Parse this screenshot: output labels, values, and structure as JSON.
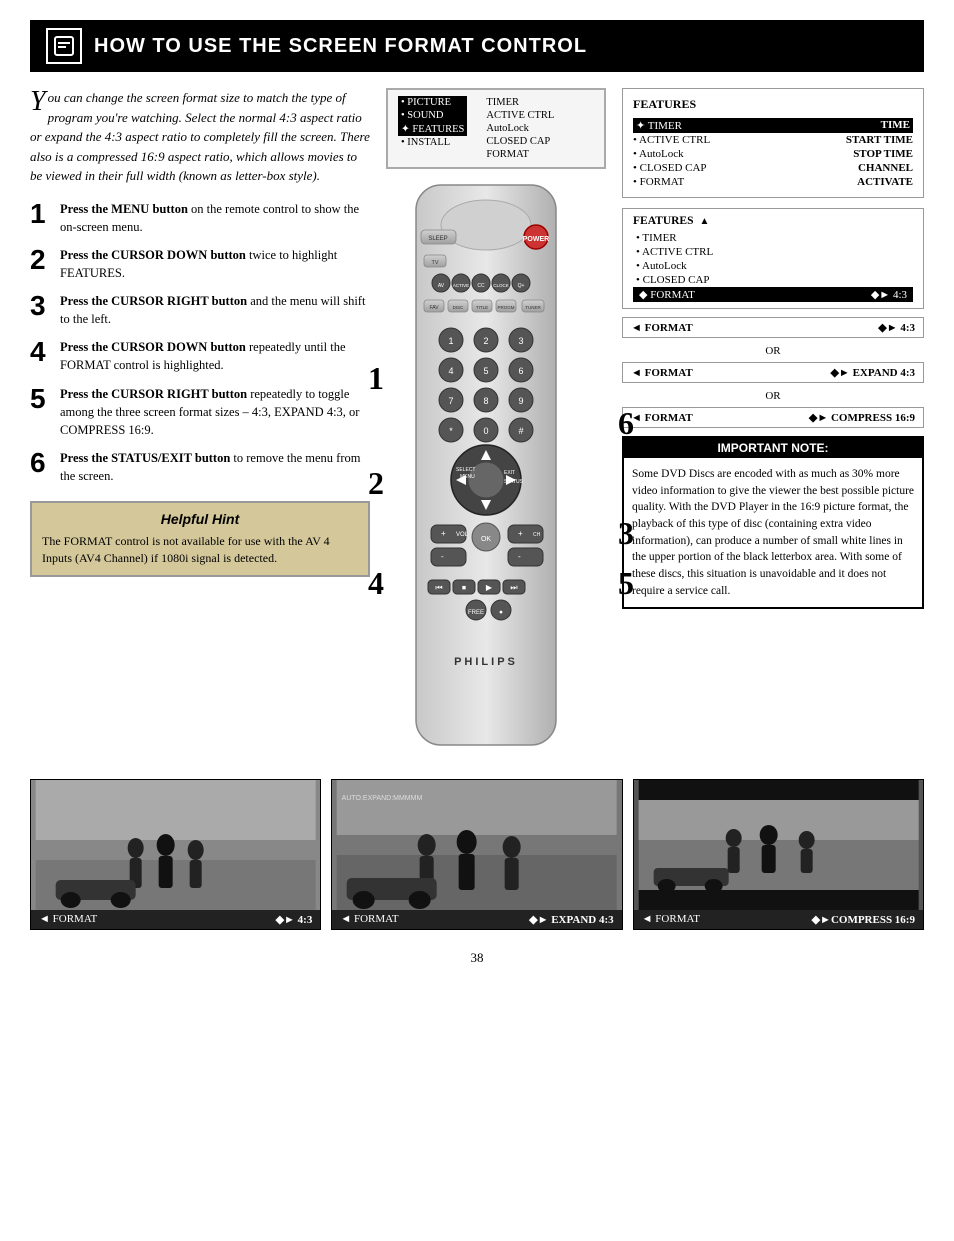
{
  "header": {
    "icon": "📋",
    "title": "How to Use the Screen Format Control"
  },
  "intro": {
    "text": "ou can change the screen format size to match the type of program you're watching. Select the normal 4:3 aspect ratio or expand the 4:3 aspect ratio to completely fill the screen. There also is a compressed 16:9 aspect ratio, which allows movies to be viewed in their full width (known as letter-box style)."
  },
  "steps": [
    {
      "number": "1",
      "bold_part": "Press the MENU button",
      "rest_part": " on the remote control to show the on-screen menu."
    },
    {
      "number": "2",
      "bold_part": "Press the CURSOR DOWN button",
      "rest_part": " twice to highlight FEATURES."
    },
    {
      "number": "3",
      "bold_part": "Press the CURSOR RIGHT button",
      "rest_part": " and the menu will shift to the left."
    },
    {
      "number": "4",
      "bold_part": "Press the CURSOR DOWN button",
      "rest_part": " repeatedly until the FORMAT control is highlighted."
    },
    {
      "number": "5",
      "bold_part": "Press the CURSOR RIGHT button",
      "rest_part": " repeatedly to toggle among the three screen format sizes – 4:3, EXPAND 4:3, or COMPRESS 16:9."
    },
    {
      "number": "6",
      "bold_part": "Press the STATUS/EXIT button",
      "rest_part": " to remove the menu from the screen."
    }
  ],
  "hint": {
    "title": "Helpful Hint",
    "text": "The FORMAT control is not available for use with the AV 4 Inputs (AV4 Channel) if 1080i signal is detected."
  },
  "onscreen_menu_1": {
    "cols": [
      {
        "header": "",
        "items": [
          {
            "label": "• PICTURE",
            "value": ""
          },
          {
            "label": "• SOUND",
            "value": ""
          },
          {
            "label": "✦ FEATURES",
            "value": "",
            "active": true
          },
          {
            "label": "• INSTALL",
            "value": ""
          }
        ]
      },
      {
        "header": "",
        "items": [
          {
            "label": "TIMER",
            "value": ""
          },
          {
            "label": "ACTIVE CTRL",
            "value": ""
          },
          {
            "label": "AutoLock",
            "value": ""
          },
          {
            "label": "CLOSED CAP",
            "value": ""
          },
          {
            "label": "FORMAT",
            "value": ""
          }
        ]
      }
    ]
  },
  "menu_features_1": {
    "title": "FEATURES",
    "items": [
      {
        "label": "✦ TIMER",
        "value": "TIME",
        "highlighted": true
      },
      {
        "label": "• ACTIVE CTRL",
        "value": "START TIME"
      },
      {
        "label": "• AutoLock",
        "value": "STOP TIME"
      },
      {
        "label": "• CLOSED CAP",
        "value": "CHANNEL"
      },
      {
        "label": "• FORMAT",
        "value": "ACTIVATE"
      }
    ]
  },
  "menu_features_2": {
    "title": "FEATURES",
    "items": [
      {
        "label": "• TIMER",
        "highlighted": false
      },
      {
        "label": "• ACTIVE CTRL",
        "highlighted": false
      },
      {
        "label": "• AutoLock",
        "highlighted": false
      },
      {
        "label": "• CLOSED CAP",
        "highlighted": false
      },
      {
        "label": "◆ FORMAT",
        "value": "◆► 4:3",
        "highlighted": true
      }
    ]
  },
  "format_rows": [
    {
      "label": "◄ FORMAT",
      "value": "◆► 4:3"
    },
    {
      "or": "OR"
    },
    {
      "label": "◄ FORMAT",
      "value": "◆► EXPAND 4:3"
    },
    {
      "or": "OR"
    },
    {
      "label": "◄ FORMAT",
      "value": "◆► COMPRESS 16:9"
    }
  ],
  "important_note": {
    "title": "IMPORTANT NOTE:",
    "text": "Some DVD Discs are encoded with as much as 30% more video information to give the viewer the best possible picture quality. With the DVD Player in the 16:9 picture format, the playback of this type of disc (containing extra video information), can produce a number of small white lines in the upper portion of the black letterbox area. With some of these discs, this situation is unavoidable and it does not require a service call."
  },
  "demo_images": [
    {
      "label": "◄ FORMAT",
      "value": "◆► 4:3",
      "type": "normal"
    },
    {
      "label": "◄ FORMAT",
      "value": "◆► EXPAND 4:3",
      "type": "expand"
    },
    {
      "label": "◄ FORMAT",
      "value": "◆► COMPRESS 16:9",
      "type": "compress"
    }
  ],
  "page_number": "38",
  "remote": {
    "brand": "PHILIPS"
  }
}
